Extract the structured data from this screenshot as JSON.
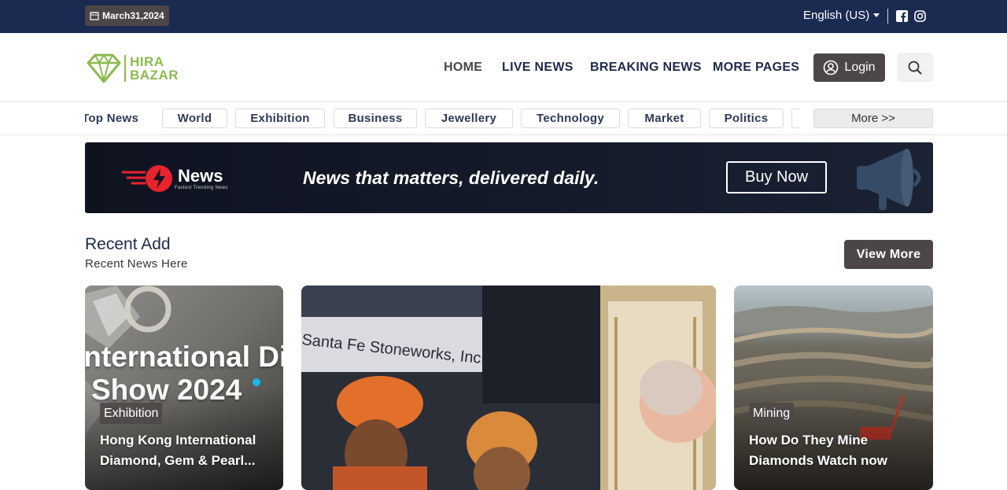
{
  "topbar": {
    "date": "March31,2024",
    "language": "English (US)",
    "social": [
      "facebook-icon",
      "instagram-icon"
    ]
  },
  "header": {
    "logo_line1": "HIRA",
    "logo_line2": "BAZAR",
    "nav": [
      "HOME",
      "LIVE NEWS",
      "BREAKING NEWS",
      "MORE PAGES"
    ],
    "login_label": "Login"
  },
  "categories": {
    "items": [
      "Top News",
      "World",
      "Exhibition",
      "Business",
      "Jewellery",
      "Technology",
      "Market",
      "Politics"
    ],
    "more_label": "More >>"
  },
  "banner": {
    "brand": "News",
    "brand_sub": "Fastest Trending News",
    "tagline": "News that matters, delivered daily.",
    "cta": "Buy Now"
  },
  "section": {
    "title": "Recent Add",
    "subtitle": "Recent News Here",
    "view_more": "View More"
  },
  "cards": [
    {
      "headline_art_1": "International Di",
      "headline_art_2": "Show 2024",
      "tag": "Exhibition",
      "title_1": "Hong Kong International",
      "title_2": "Diamond, Gem & Pearl..."
    },
    {
      "sign": "Santa Fe Stoneworks, Inc."
    },
    {
      "tag": "Mining",
      "title_1": "How Do They Mine",
      "title_2": "Diamonds Watch now"
    }
  ],
  "colors": {
    "topbar_bg": "#1b2a50",
    "accent_dark": "#4c4646",
    "logo_green": "#8bbb4f",
    "nav_text": "#1f2a4a"
  }
}
